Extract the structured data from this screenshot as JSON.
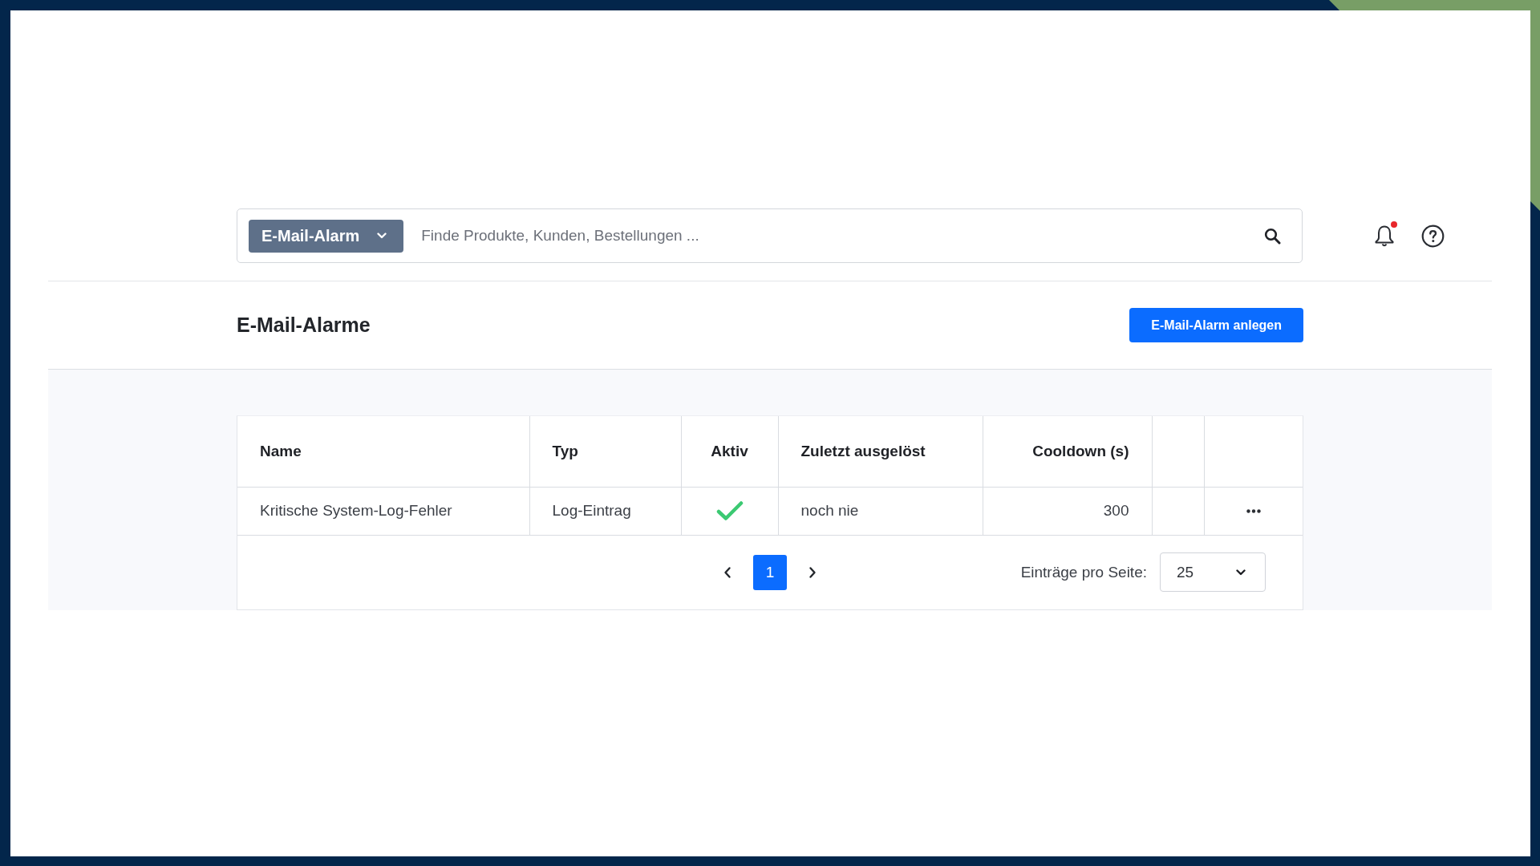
{
  "search": {
    "scope": "E-Mail-Alarm",
    "placeholder": "Finde Produkte, Kunden, Bestellungen ..."
  },
  "notifications": {
    "unread": true
  },
  "page_header": {
    "title": "E-Mail-Alarme",
    "create_button": "E-Mail-Alarm anlegen"
  },
  "table": {
    "columns": [
      {
        "kind": "text",
        "label": "Name"
      },
      {
        "kind": "text",
        "label": "Typ"
      },
      {
        "kind": "check",
        "label": "Aktiv"
      },
      {
        "kind": "text",
        "label": "Zuletzt ausgelöst"
      },
      {
        "kind": "number",
        "label": "Cooldown (s)"
      },
      {
        "kind": "blank"
      },
      {
        "kind": "actions"
      }
    ],
    "rows": [
      {
        "name": "Kritische System-Log-Fehler",
        "type": "Log-Eintrag",
        "active": true,
        "last_triggered": "noch nie",
        "cooldown": "300"
      }
    ]
  },
  "pagination": {
    "pages": [
      {
        "label": "1",
        "selected": true
      }
    ],
    "page_size_label": "Einträge pro Seite:",
    "page_size": "25"
  }
}
